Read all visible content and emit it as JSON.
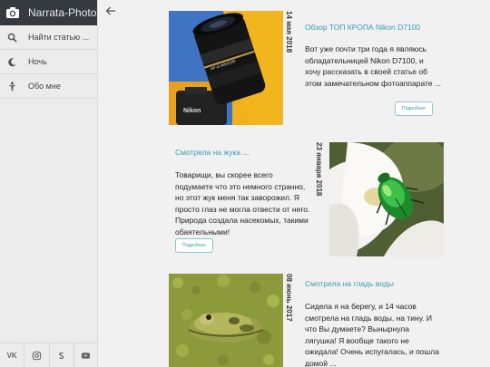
{
  "brand": {
    "title": "Narrata-Photo",
    "icon": "camera-icon"
  },
  "menu": [
    {
      "label": "Найти статью ...",
      "icon": "search-icon"
    },
    {
      "label": "Ночь",
      "icon": "moon-icon"
    },
    {
      "label": "Обо мне",
      "icon": "person-icon"
    }
  ],
  "social": [
    "vk-icon",
    "instagram-icon",
    "skype-icon",
    "youtube-icon"
  ],
  "social_labels": {
    "vk": "VK"
  },
  "posts": [
    {
      "title": "Обзор ТОП КРОПА Nikon D7100",
      "date": "14 мая 2018",
      "text": "Вот уже почти три года я являюсь обладательницей Nikon D7100, и хочу рассказать в своей статье об этом замечательном фотоаппарате ...",
      "button": "Подробнее"
    },
    {
      "title": "Смотрела на жука ...",
      "date": "23 января 2018",
      "text": "Товарищи, вы скорее всего подумаете что это немного странно, но этот жук меня так заворожил. Я просто глаз не могла отвести от него. Природа создала насекомых, такими обаятельными!",
      "button": "Подробнее"
    },
    {
      "title": "Смотрела на гладь воды",
      "date": "08 июнь 2017",
      "text": "Сидела я на берегу, и 14 часов смотрела на гладь воды, на тину. И что Вы думаете? Вынырнула лягушка! Я вообще такого не ожидала! Очень испугалась, и пошла домой ...",
      "button": ""
    }
  ],
  "colors": {
    "accent": "#3d9ab0",
    "brand_bg": "#343a40",
    "sidebar_bg": "#ececec"
  }
}
